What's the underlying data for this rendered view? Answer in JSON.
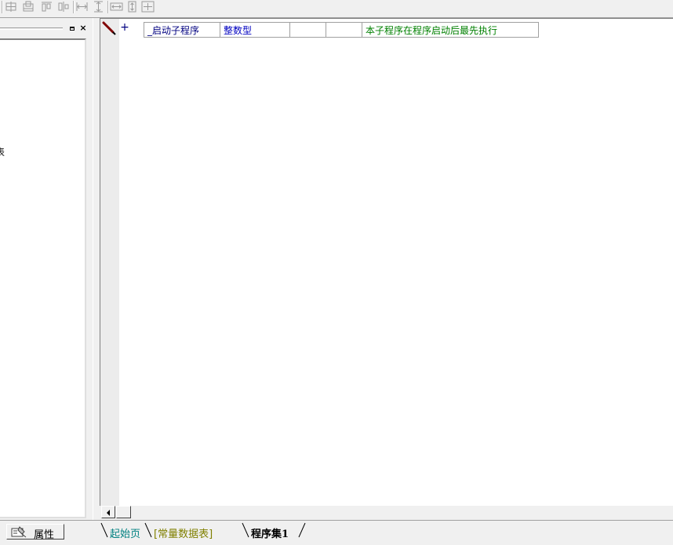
{
  "toolbar": {
    "icons": [
      "align-left-icon",
      "align-center-icon",
      "align-top-icon",
      "align-middle-icon",
      "space-horizontal-icon",
      "space-vertical-icon",
      "same-width-icon",
      "same-height-icon",
      "same-size-icon"
    ]
  },
  "left_panel": {
    "partial_text": "表",
    "restore_icon": "restore-icon",
    "close_icon": "close-icon"
  },
  "program": {
    "row": {
      "name": "_启动子程序",
      "return_type": "整数型",
      "col3": "",
      "col4": "",
      "note": "本子程序在程序启动后最先执行"
    }
  },
  "bottom": {
    "property_tab": "属性",
    "tabs": [
      {
        "label": "起始页",
        "color": "#008080",
        "active": false
      },
      {
        "label": "[常量数据表]",
        "color": "#808000",
        "active": false
      },
      {
        "label": "程序集1",
        "color": "#000000",
        "active": true
      }
    ]
  },
  "colors": {
    "subroutine_name": "#000080",
    "type": "#0000c0",
    "comment": "#008000"
  }
}
